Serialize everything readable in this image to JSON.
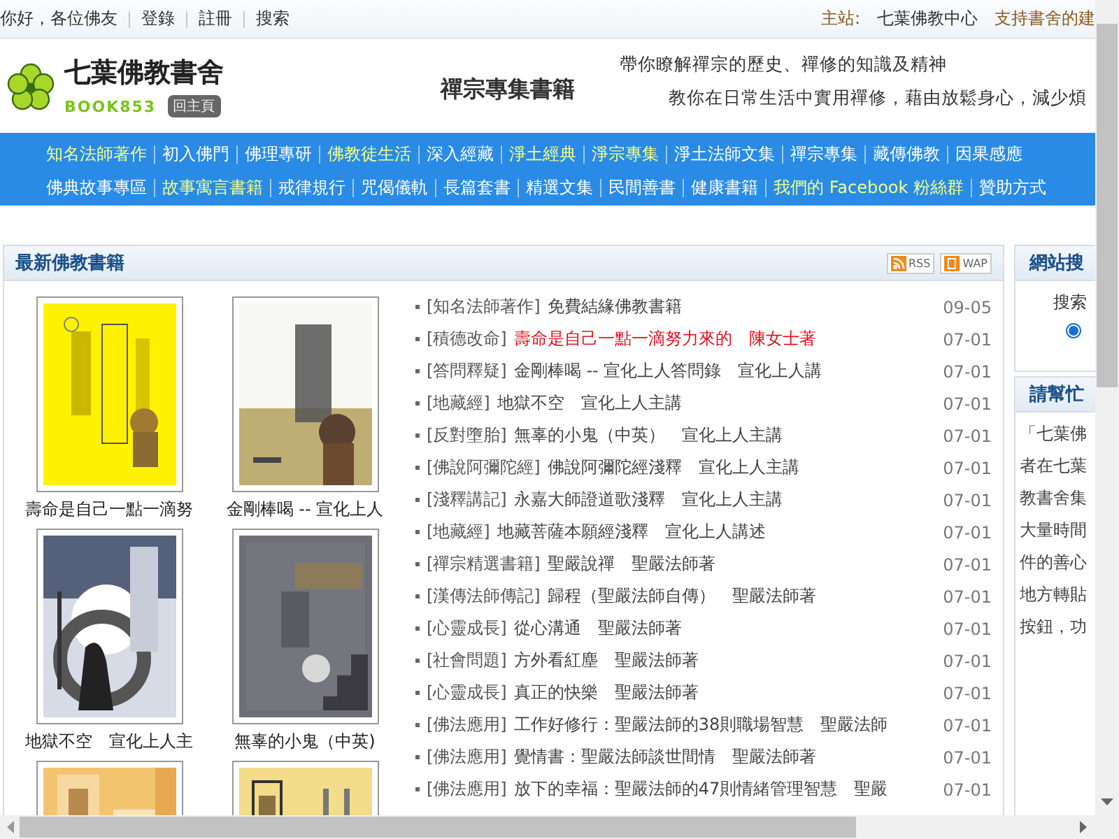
{
  "top_bar": {
    "greeting": "你好，各位佛友",
    "links": [
      "登錄",
      "註冊",
      "搜索"
    ],
    "main_site_label": "主站:",
    "main_site": "七葉佛教中心",
    "support": "支持書舍的建"
  },
  "header": {
    "site_name": "七葉佛教書舍",
    "site_code": "BOOK853",
    "home_button": "回主頁",
    "section_title": "禪宗專集書籍",
    "taglines": [
      "帶你瞭解禪宗的歷史、禪修的知識及精神",
      "教你在日常生活中實用禪修，藉由放鬆身心，減少煩"
    ]
  },
  "nav": [
    [
      {
        "label": "知名法師著作",
        "featured": true
      },
      {
        "label": "初入佛門",
        "featured": false
      },
      {
        "label": "佛理專研",
        "featured": false
      },
      {
        "label": "佛教徒生活",
        "featured": true
      },
      {
        "label": "深入經藏",
        "featured": false
      },
      {
        "label": "淨土經典",
        "featured": true
      },
      {
        "label": "淨宗專集",
        "featured": true
      },
      {
        "label": "淨土法師文集",
        "featured": false
      },
      {
        "label": "禪宗專集",
        "featured": false
      },
      {
        "label": "藏傳佛教",
        "featured": false
      },
      {
        "label": "因果感應",
        "featured": false
      }
    ],
    [
      {
        "label": "佛典故事專區",
        "featured": false
      },
      {
        "label": "故事寓言書籍",
        "featured": true
      },
      {
        "label": "戒律規行",
        "featured": false
      },
      {
        "label": "咒偈儀軌",
        "featured": false
      },
      {
        "label": "長篇套書",
        "featured": false
      },
      {
        "label": "精選文集",
        "featured": false
      },
      {
        "label": "民間善書",
        "featured": false
      },
      {
        "label": "健康書籍",
        "featured": false
      },
      {
        "label": "我們的 Facebook 粉絲群",
        "featured": true
      },
      {
        "label": "贊助方式",
        "featured": false
      }
    ]
  ],
  "latest_books": {
    "title": "最新佛教書籍",
    "feeds": [
      "RSS",
      "WAP"
    ],
    "covers": [
      {
        "kind": "picture",
        "caption": "壽命是自己一點一滴努"
      },
      {
        "kind": "picture",
        "caption": "金剛棒喝 -- 宣化上人"
      },
      {
        "kind": "picture",
        "caption": "地獄不空　宣化上人主"
      },
      {
        "kind": "picture",
        "caption": "無辜的小鬼（中英)"
      },
      {
        "kind": "picture"
      },
      {
        "kind": "picture"
      }
    ],
    "items": [
      {
        "category": "[知名法師著作]",
        "title": "免費結緣佛教書籍",
        "date": "09-05",
        "highlighted": false
      },
      {
        "category": "[積德改命]",
        "title": "壽命是自己一點一滴努力來的　陳女士著",
        "date": "07-01",
        "highlighted": true
      },
      {
        "category": "[答問釋疑]",
        "title": "金剛棒喝 -- 宣化上人答問錄　宣化上人講",
        "date": "07-01",
        "highlighted": false
      },
      {
        "category": "[地藏經]",
        "title": "地獄不空　宣化上人主講",
        "date": "07-01",
        "highlighted": false
      },
      {
        "category": "[反對墮胎]",
        "title": "無辜的小鬼（中英）　宣化上人主講",
        "date": "07-01",
        "highlighted": false
      },
      {
        "category": "[佛說阿彌陀經]",
        "title": "佛說阿彌陀經淺釋　宣化上人主講",
        "date": "07-01",
        "highlighted": false
      },
      {
        "category": "[淺釋講記]",
        "title": "永嘉大師證道歌淺釋　宣化上人主講",
        "date": "07-01",
        "highlighted": false
      },
      {
        "category": "[地藏經]",
        "title": "地藏菩薩本願經淺釋　宣化上人講述",
        "date": "07-01",
        "highlighted": false
      },
      {
        "category": "[禪宗精選書籍]",
        "title": "聖嚴說禪　聖嚴法師著",
        "date": "07-01",
        "highlighted": false
      },
      {
        "category": "[漢傳法師傳記]",
        "title": "歸程（聖嚴法師自傳）　聖嚴法師著",
        "date": "07-01",
        "highlighted": false
      },
      {
        "category": "[心靈成長]",
        "title": "從心溝通　聖嚴法師著",
        "date": "07-01",
        "highlighted": false
      },
      {
        "category": "[社會問題]",
        "title": "方外看紅塵　聖嚴法師著",
        "date": "07-01",
        "highlighted": false
      },
      {
        "category": "[心靈成長]",
        "title": "真正的快樂　聖嚴法師著",
        "date": "07-01",
        "highlighted": false
      },
      {
        "category": "[佛法應用]",
        "title": "工作好修行：聖嚴法師的38則職場智慧　聖嚴法師",
        "date": "07-01",
        "highlighted": false
      },
      {
        "category": "[佛法應用]",
        "title": "覺情書：聖嚴法師談世間情　聖嚴法師著",
        "date": "07-01",
        "highlighted": false
      },
      {
        "category": "[佛法應用]",
        "title": "放下的幸福：聖嚴法師的47則情緒管理智慧　聖嚴",
        "date": "07-01",
        "highlighted": false
      }
    ]
  },
  "site_search": {
    "title": "網站搜",
    "label": "搜索",
    "radio": {
      "selected": true
    }
  },
  "help_panel": {
    "title": "請幫忙",
    "lines": [
      "「七葉佛",
      "者在七葉",
      "教書舍集",
      "大量時間",
      "件的善心",
      "地方轉貼",
      "按鈕，功"
    ]
  }
}
